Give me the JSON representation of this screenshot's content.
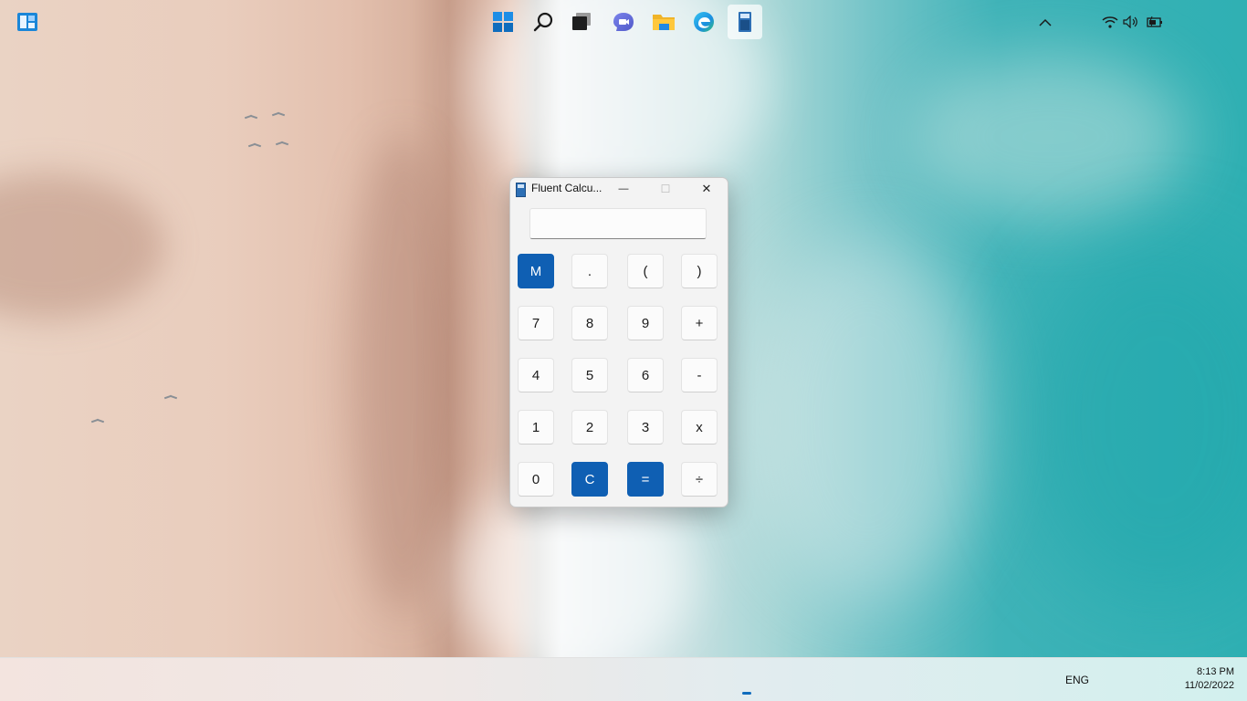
{
  "window": {
    "title": "Fluent Calcu...",
    "minimize_glyph": "—",
    "maximize_glyph": "☐",
    "close_glyph": "✕",
    "display_value": ""
  },
  "keys": [
    {
      "label": "M",
      "name": "memory-button",
      "accent": true
    },
    {
      "label": ".",
      "name": "decimal-button",
      "accent": false
    },
    {
      "label": "(",
      "name": "open-paren-button",
      "accent": false
    },
    {
      "label": ")",
      "name": "close-paren-button",
      "accent": false
    },
    {
      "label": "7",
      "name": "seven-button",
      "accent": false
    },
    {
      "label": "8",
      "name": "eight-button",
      "accent": false
    },
    {
      "label": "9",
      "name": "nine-button",
      "accent": false
    },
    {
      "label": "+",
      "name": "add-button",
      "accent": false
    },
    {
      "label": "4",
      "name": "four-button",
      "accent": false
    },
    {
      "label": "5",
      "name": "five-button",
      "accent": false
    },
    {
      "label": "6",
      "name": "six-button",
      "accent": false
    },
    {
      "label": "-",
      "name": "subtract-button",
      "accent": false
    },
    {
      "label": "1",
      "name": "one-button",
      "accent": false
    },
    {
      "label": "2",
      "name": "two-button",
      "accent": false
    },
    {
      "label": "3",
      "name": "three-button",
      "accent": false
    },
    {
      "label": "x",
      "name": "multiply-button",
      "accent": false
    },
    {
      "label": "0",
      "name": "zero-button",
      "accent": false
    },
    {
      "label": "C",
      "name": "clear-button",
      "accent": true
    },
    {
      "label": "=",
      "name": "equals-button",
      "accent": true
    },
    {
      "label": "÷",
      "name": "divide-button",
      "accent": false
    }
  ],
  "taskbar": {
    "icons": [
      "widgets-icon",
      "start-icon",
      "search-icon",
      "task-view-icon",
      "chat-icon",
      "file-explorer-icon",
      "edge-icon",
      "fluent-calculator-icon"
    ],
    "tray": {
      "language": "ENG",
      "time": "8:13 PM",
      "date": "11/02/2022"
    }
  },
  "colors": {
    "accent": "#0f5fb3",
    "window_bg": "#f3f3f3"
  }
}
